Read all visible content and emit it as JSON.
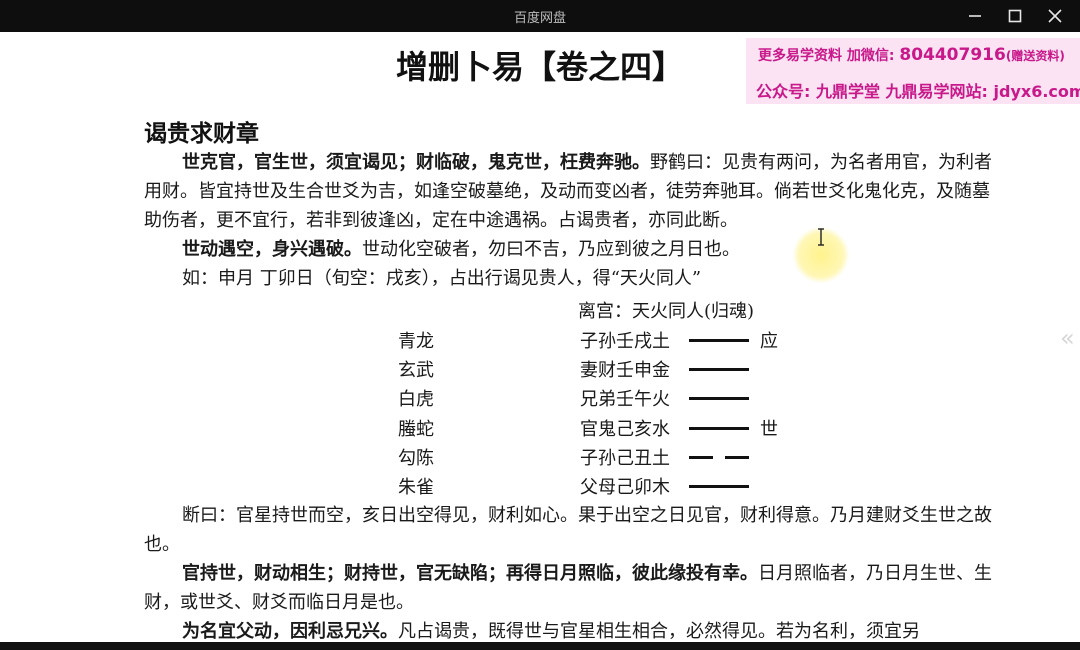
{
  "window": {
    "title": "百度网盘"
  },
  "watermark": {
    "line1_prefix": "更多易学资料 加微信:",
    "line1_number": "804407916",
    "line1_suffix": "(赠送资料)",
    "line2": "公众号: 九鼎学堂 九鼎易学网站: jdyx6.com"
  },
  "document": {
    "title": "增删卜易【卷之四】",
    "section_heading": "谒贵求财章",
    "p1_bold": "世克官，官生世，须宜谒见；财临破，鬼克世，枉费奔驰。",
    "p1_text": "野鹤曰：见贵有两问，为名者用官，为利者用财。皆宜持世及生合世爻为吉，如逢空破墓绝，及动而变凶者，徒劳奔驰耳。倘若世爻化鬼化克，及随墓助伤者，更不宜行，若非到彼逢凶，定在中途遇祸。占谒贵者，亦同此断。",
    "p2_bold": "世动遇空，身兴遇破。",
    "p2_text": "世动化空破者，勿曰不吉，乃应到彼之月日也。",
    "example": "如：申月 丁卯日（旬空：戌亥），占出行谒见贵人，得“天火同人”",
    "hexagram_header": "离宫：天火同人(归魂)",
    "hexagram_lines": [
      {
        "spirit": "青龙",
        "name": "子孙壬戌土",
        "type": "yang",
        "marker": "应"
      },
      {
        "spirit": "玄武",
        "name": "妻财壬申金",
        "type": "yang",
        "marker": ""
      },
      {
        "spirit": "白虎",
        "name": "兄弟壬午火",
        "type": "yang",
        "marker": ""
      },
      {
        "spirit": "螣蛇",
        "name": "官鬼己亥水",
        "type": "yang",
        "marker": "世"
      },
      {
        "spirit": "勾陈",
        "name": "子孙己丑土",
        "type": "yin",
        "marker": ""
      },
      {
        "spirit": "朱雀",
        "name": "父母己卯木",
        "type": "yang",
        "marker": ""
      }
    ],
    "p3_text": "断曰：官星持世而空，亥日出空得见，财利如心。果于出空之日见官，财利得意。乃月建财爻生世之故也。",
    "p4_bold": "官持世，财动相生；财持世，官无缺陷；再得日月照临，彼此缘投有幸。",
    "p4_text": "日月照临者，乃日月生世、生财，或世爻、财爻而临日月是也。",
    "p5_bold": "为名宜父动，因利忌兄兴。",
    "p5_text": "凡占谒贵，既得世与官星相生相合，必然得见。若为名利，须宜另"
  }
}
